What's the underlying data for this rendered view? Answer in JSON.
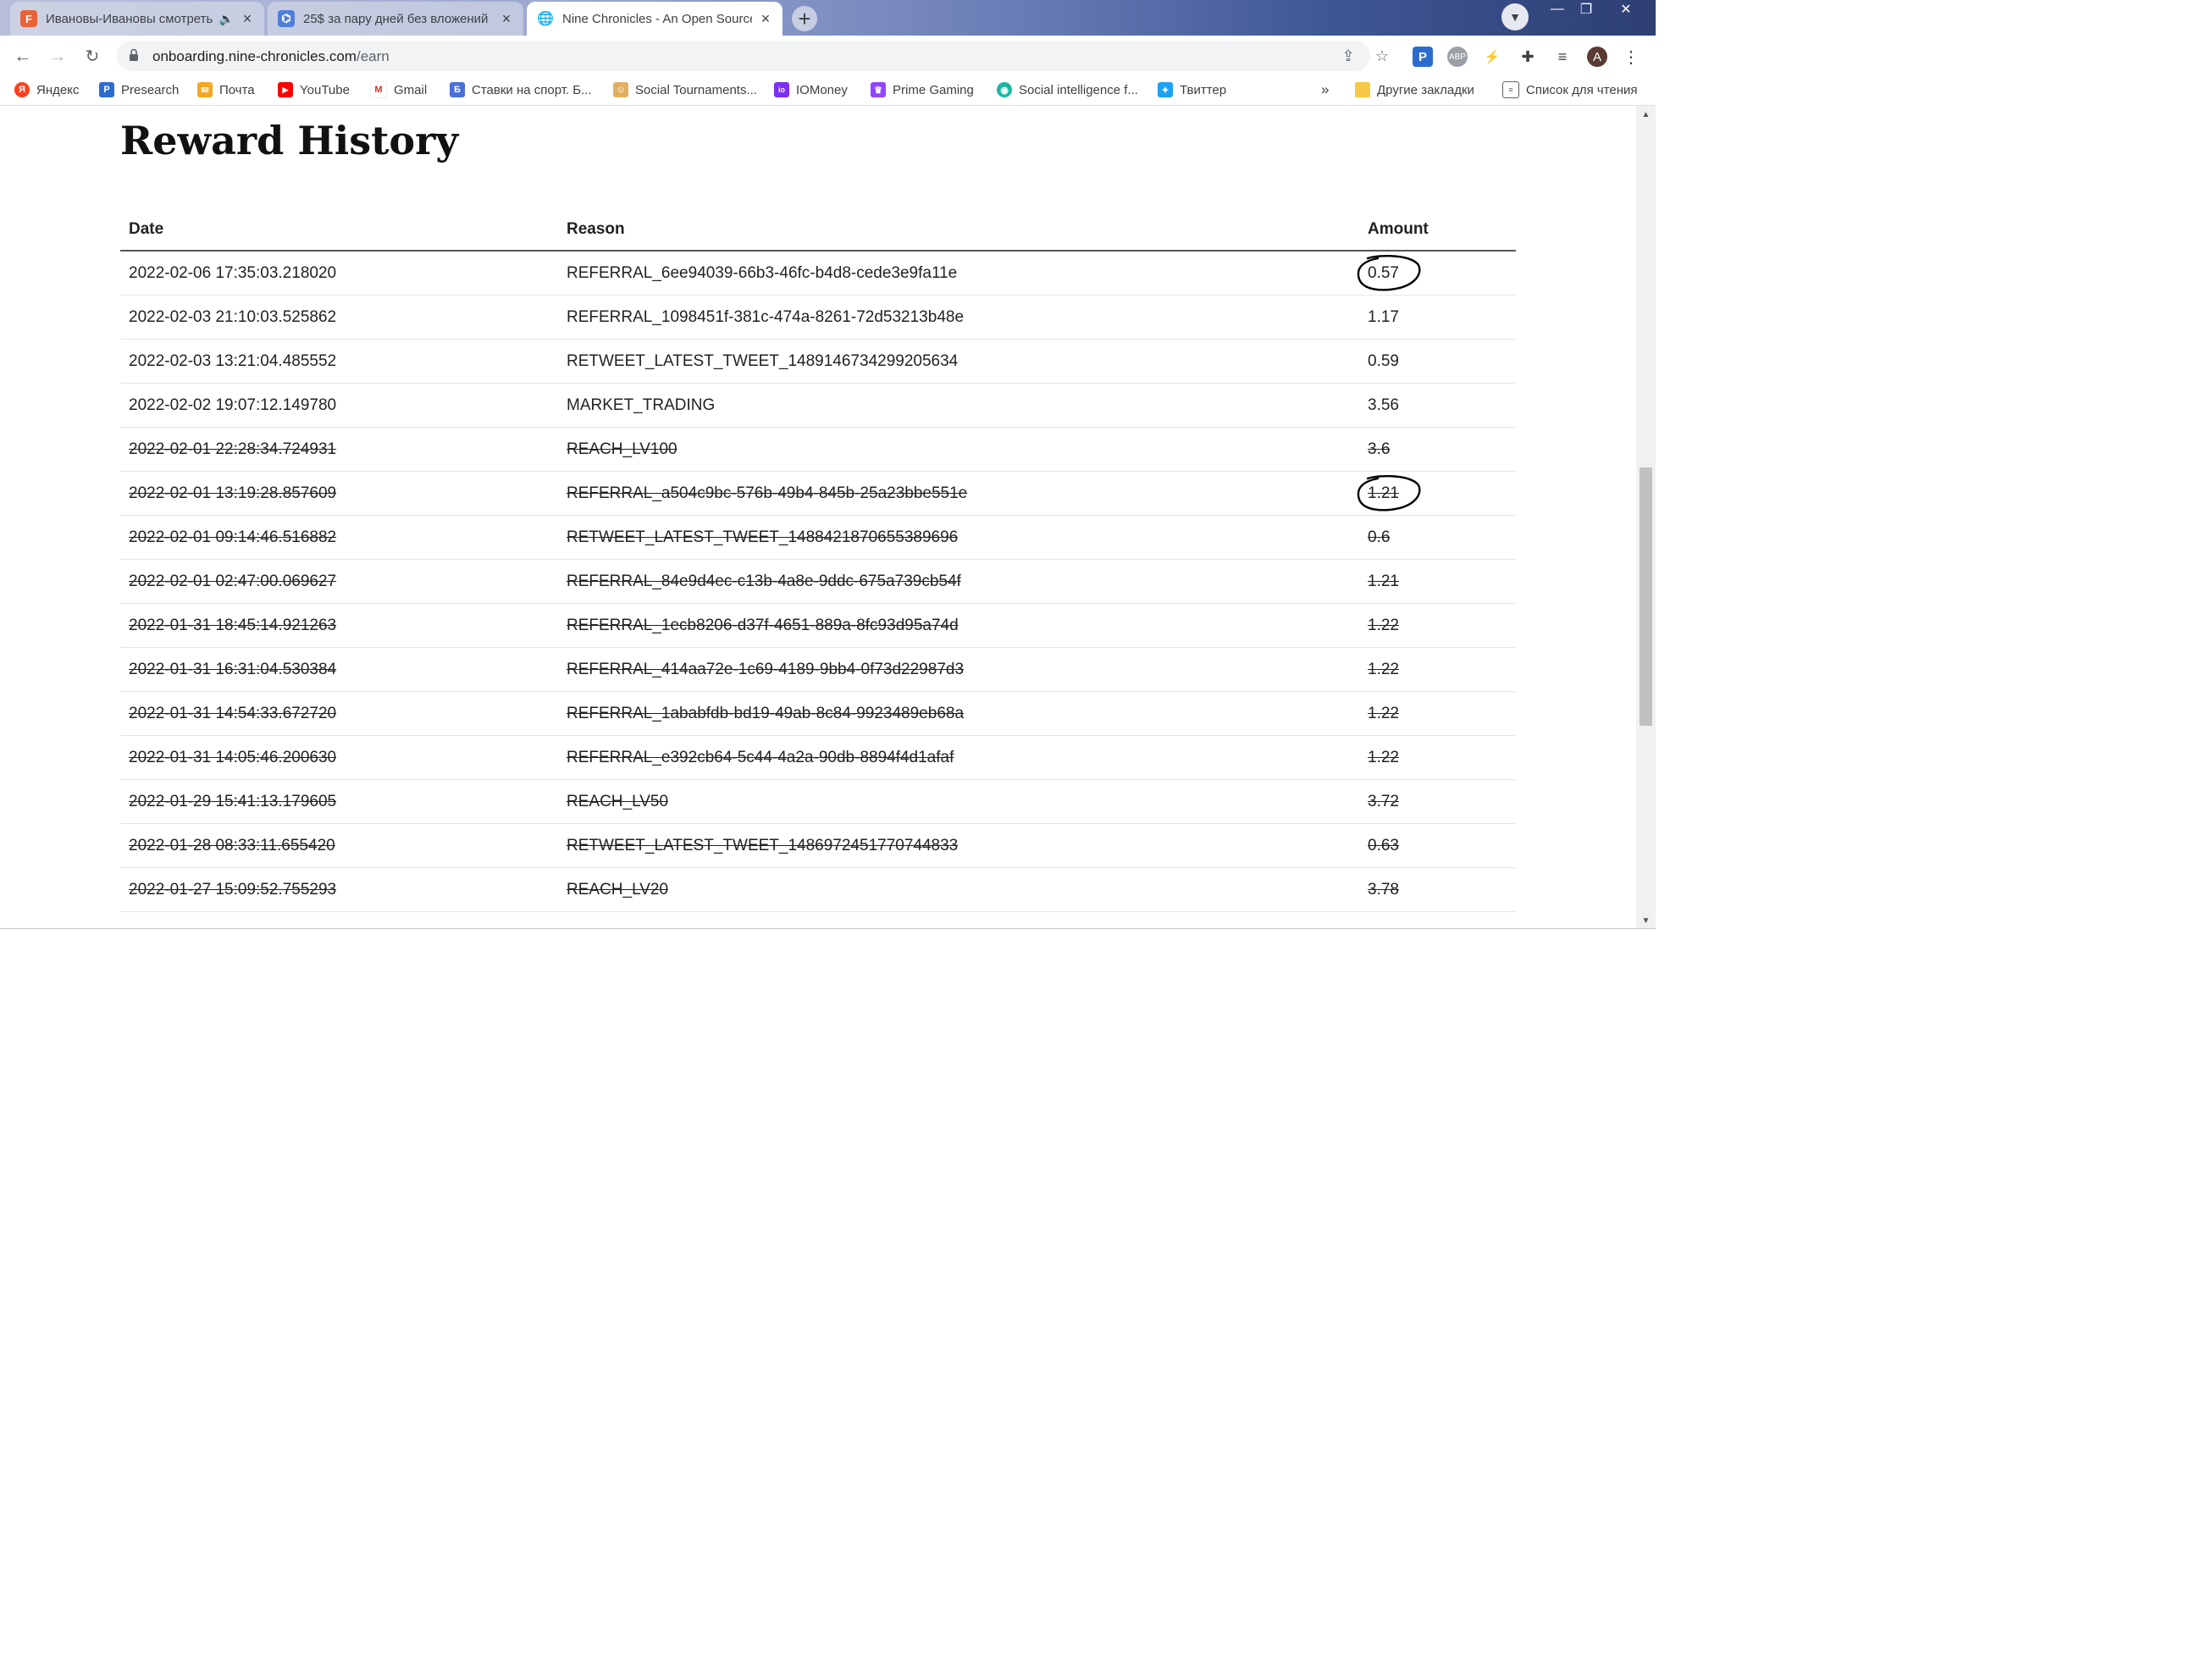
{
  "tabs": [
    {
      "title": "Ивановы-Ивановы смотреть",
      "favicon": "F",
      "color": "#e8633a",
      "muted": true,
      "active": false
    },
    {
      "title": "25$ за пару дней без вложений",
      "favicon": "⌬",
      "color": "#4f7fd9",
      "muted": false,
      "active": false
    },
    {
      "title": "Nine Chronicles - An Open Source",
      "favicon": "🌐",
      "color": "#5f6368",
      "muted": false,
      "active": true
    }
  ],
  "omnibox": {
    "host": "onboarding.nine-chronicles.com",
    "path": "/earn"
  },
  "profile_initial": "A",
  "bookmarks": [
    {
      "label": "Яндекс",
      "icon": "Я",
      "color": "#fc3f1d"
    },
    {
      "label": "Presearch",
      "icon": "P",
      "color": "#2d6ccf"
    },
    {
      "label": "Почта",
      "icon": "✉",
      "color": "#f5a623"
    },
    {
      "label": "YouTube",
      "icon": "▶",
      "color": "#ff0000"
    },
    {
      "label": "Gmail",
      "icon": "M",
      "color": "#d93025"
    },
    {
      "label": "Ставки на спорт. Б...",
      "icon": "Б",
      "color": "#4a6fd8"
    },
    {
      "label": "Social Tournaments...",
      "icon": "☺",
      "color": "#e0b060"
    },
    {
      "label": "IOMoney",
      "icon": "io",
      "color": "#7b2ff7"
    },
    {
      "label": "Prime Gaming",
      "icon": "♛",
      "color": "#9146ff"
    },
    {
      "label": "Social intelligence f...",
      "icon": "◉",
      "color": "#19b7a2"
    },
    {
      "label": "Твиттер",
      "icon": "✦",
      "color": "#1da1f2"
    }
  ],
  "bookmarks_more": "»",
  "other_bookmarks": "Другие закладки",
  "reading_list": "Список для чтения",
  "page": {
    "title": "Reward History"
  },
  "table": {
    "headers": {
      "date": "Date",
      "reason": "Reason",
      "amount": "Amount"
    },
    "rows": [
      {
        "date": "2022-02-06 17:35:03.218020",
        "reason": "REFERRAL_6ee94039-66b3-46fc-b4d8-cede3e9fa11e",
        "amount": "0.57",
        "struck": false,
        "circled": true
      },
      {
        "date": "2022-02-03 21:10:03.525862",
        "reason": "REFERRAL_1098451f-381c-474a-8261-72d53213b48e",
        "amount": "1.17",
        "struck": false,
        "circled": false
      },
      {
        "date": "2022-02-03 13:21:04.485552",
        "reason": "RETWEET_LATEST_TWEET_1489146734299205634",
        "amount": "0.59",
        "struck": false,
        "circled": false
      },
      {
        "date": "2022-02-02 19:07:12.149780",
        "reason": "MARKET_TRADING",
        "amount": "3.56",
        "struck": false,
        "circled": false
      },
      {
        "date": "2022-02-01 22:28:34.724931",
        "reason": "REACH_LV100",
        "amount": "3.6",
        "struck": true,
        "circled": false
      },
      {
        "date": "2022-02-01 13:19:28.857609",
        "reason": "REFERRAL_a504c9bc-576b-49b4-845b-25a23bbe551e",
        "amount": "1.21",
        "struck": true,
        "circled": true
      },
      {
        "date": "2022-02-01 09:14:46.516882",
        "reason": "RETWEET_LATEST_TWEET_1488421870655389696",
        "amount": "0.6",
        "struck": true,
        "circled": false
      },
      {
        "date": "2022-02-01 02:47:00.069627",
        "reason": "REFERRAL_84e9d4ec-c13b-4a8e-9ddc-675a739cb54f",
        "amount": "1.21",
        "struck": true,
        "circled": false
      },
      {
        "date": "2022-01-31 18:45:14.921263",
        "reason": "REFERRAL_1ecb8206-d37f-4651-889a-8fc93d95a74d",
        "amount": "1.22",
        "struck": true,
        "circled": false
      },
      {
        "date": "2022-01-31 16:31:04.530384",
        "reason": "REFERRAL_414aa72e-1c69-4189-9bb4-0f73d22987d3",
        "amount": "1.22",
        "struck": true,
        "circled": false
      },
      {
        "date": "2022-01-31 14:54:33.672720",
        "reason": "REFERRAL_1ababfdb-bd19-49ab-8c84-9923489eb68a",
        "amount": "1.22",
        "struck": true,
        "circled": false
      },
      {
        "date": "2022-01-31 14:05:46.200630",
        "reason": "REFERRAL_e392cb64-5c44-4a2a-90db-8894f4d1afaf",
        "amount": "1.22",
        "struck": true,
        "circled": false
      },
      {
        "date": "2022-01-29 15:41:13.179605",
        "reason": "REACH_LV50",
        "amount": "3.72",
        "struck": true,
        "circled": false
      },
      {
        "date": "2022-01-28 08:33:11.655420",
        "reason": "RETWEET_LATEST_TWEET_1486972451770744833",
        "amount": "0.63",
        "struck": true,
        "circled": false
      },
      {
        "date": "2022-01-27 15:09:52.755293",
        "reason": "REACH_LV20",
        "amount": "3.78",
        "struck": true,
        "circled": false
      }
    ]
  }
}
